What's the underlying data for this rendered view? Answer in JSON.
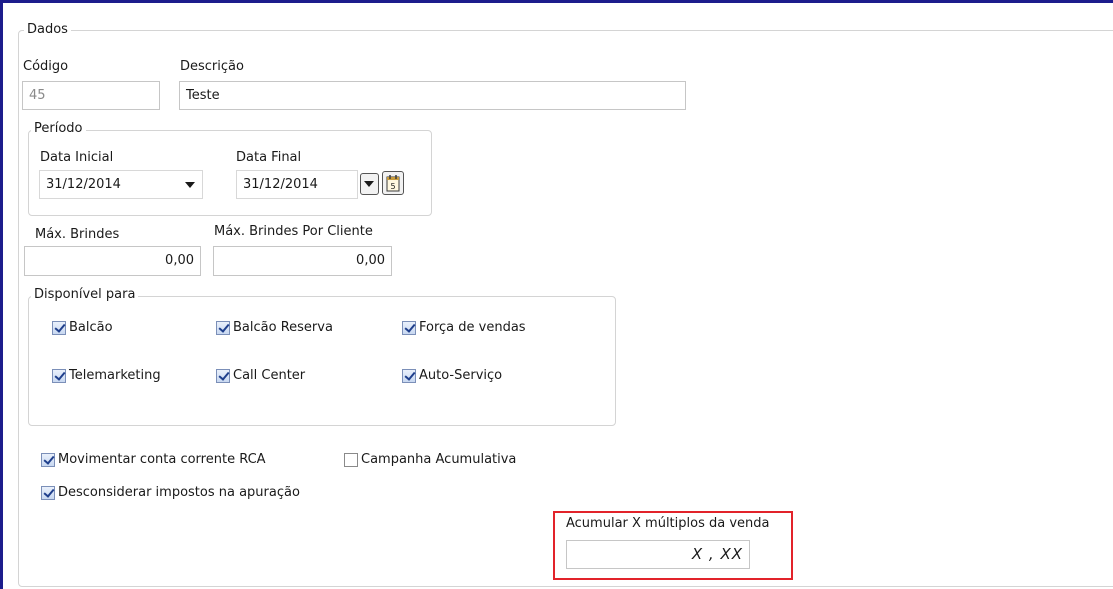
{
  "dados": {
    "legend": "Dados",
    "codigo_label": "Código",
    "codigo_value": "45",
    "descricao_label": "Descrição",
    "descricao_value": "Teste"
  },
  "periodo": {
    "legend": "Período",
    "data_inicial_label": "Data Inicial",
    "data_inicial_value": "31/12/2014",
    "data_final_label": "Data Final",
    "data_final_value": "31/12/2014"
  },
  "brindes": {
    "max_label": "Máx. Brindes",
    "max_value": "0,00",
    "max_por_cliente_label": "Máx. Brindes Por Cliente",
    "max_por_cliente_value": "0,00"
  },
  "disponivel": {
    "legend": "Disponível para",
    "items": [
      {
        "label": "Balcão",
        "checked": true
      },
      {
        "label": "Balcão Reserva",
        "checked": true
      },
      {
        "label": "Força de vendas",
        "checked": true
      },
      {
        "label": "Telemarketing",
        "checked": true
      },
      {
        "label": "Call Center",
        "checked": true
      },
      {
        "label": "Auto-Serviço",
        "checked": true
      }
    ]
  },
  "options": {
    "movimentar": {
      "label": "Movimentar conta corrente RCA",
      "checked": true
    },
    "campanha": {
      "label": "Campanha Acumulativa",
      "checked": false
    },
    "desconsiderar": {
      "label": "Desconsiderar impostos na apuração",
      "checked": true
    }
  },
  "acumular": {
    "label": "Acumular X múltiplos da venda",
    "value": "X , XX",
    "highlight_color": "#e2232a"
  },
  "icons": {
    "calendar": "calendar-icon",
    "dropdown": "chevron-down-icon"
  }
}
